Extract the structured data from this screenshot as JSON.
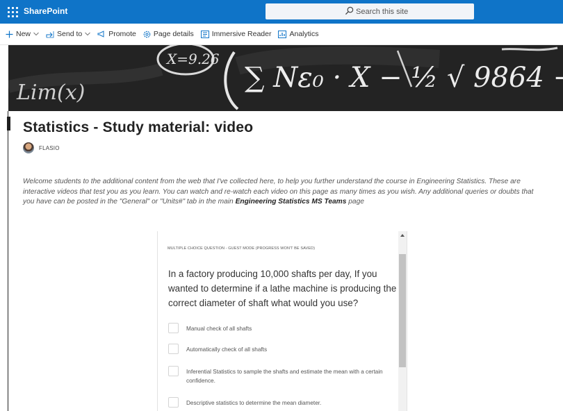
{
  "app": {
    "name": "SharePoint"
  },
  "search": {
    "placeholder": "Search this site"
  },
  "commands": [
    {
      "label": "New",
      "icon": "plus-icon",
      "dropdown": true
    },
    {
      "label": "Send to",
      "icon": "share-icon",
      "dropdown": true
    },
    {
      "label": "Promote",
      "icon": "megaphone-icon",
      "dropdown": false
    },
    {
      "label": "Page details",
      "icon": "gear-icon",
      "dropdown": false
    },
    {
      "label": "Immersive Reader",
      "icon": "reader-icon",
      "dropdown": false
    },
    {
      "label": "Analytics",
      "icon": "chart-icon",
      "dropdown": false
    }
  ],
  "banner": {
    "equation_a": "X=9.26",
    "equation_b": "∑ Nε₀ · X − ½ √ 9864 +",
    "equation_c": "Lim(x)"
  },
  "page": {
    "title": "Statistics - Study material: video",
    "author": "FLASIO",
    "description_start": "Welcome students to the additional content from the web that I've collected here, to help you further understand the course in Engineering Statistics. These are interactive videos that test you as you learn. You can watch and re-watch each video on this page as many times as you wish. Any additional queries or doubts that you have can be posted in the \"General\" or \"Units#\" tab in the main ",
    "description_bold": "Engineering Statistics MS Teams",
    "description_end": " page"
  },
  "quiz": {
    "label": "MULTIPLE CHOICE QUESTION - Guest mode (progress won't be saved)",
    "question": "In a factory producing 10,000 shafts per day, If you wanted to determine if a lathe machine is producing the correct diameter of shaft what would you use?",
    "options": [
      "Manual check of all shafts",
      "Automatically check of all shafts",
      "Inferential Statistics to sample the shafts and estimate the mean with a certain confidence.",
      "Descriptive statistics to determine the mean diameter."
    ]
  },
  "colors": {
    "suite_bar": "#0f74c8",
    "accent": "#0f74c8"
  }
}
